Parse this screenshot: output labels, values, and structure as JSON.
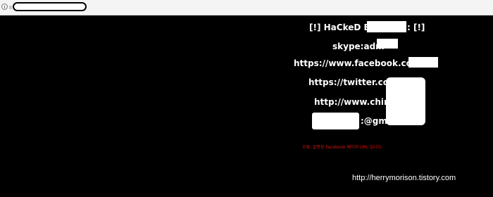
{
  "browser": {
    "url_value": "",
    "icons": {
      "info": "info-circle-icon"
    }
  },
  "page": {
    "hacked_prefix": "[!] HaCkeD By",
    "hacked_suffix": ": [!]",
    "skype": "skype:adm",
    "facebook": "https://www.facebook.com/",
    "twitter": "https://twitter.co",
    "website": "http://www.chin",
    "email": ":@gma",
    "error_message": "오류: 잘못된 Facebook 페이지 URL 입니다."
  },
  "watermark": "http://herrymorison.tistory.com",
  "colors": {
    "background": "#000000",
    "text": "#ffffff",
    "error": "#e01010"
  }
}
